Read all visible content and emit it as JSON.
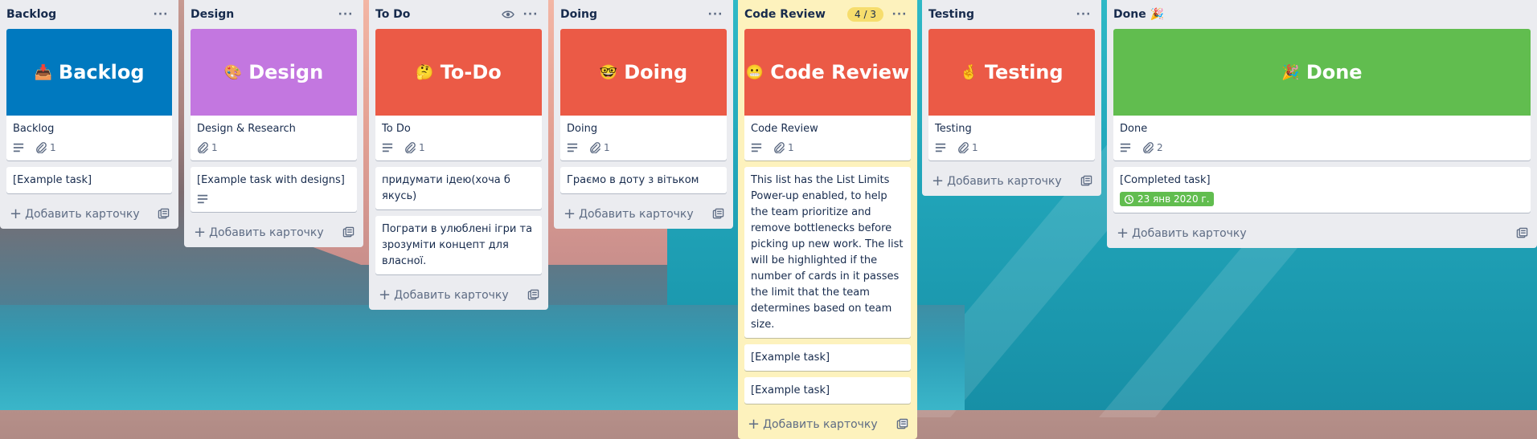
{
  "add_card_label": "Добавить карточку",
  "lists": [
    {
      "key": "backlog",
      "title": "Backlog",
      "cover": {
        "emoji": "📥",
        "text": "Backlog",
        "color": "#0079bf"
      },
      "cover_card": {
        "title": "Backlog",
        "description": true,
        "attachments": "1"
      },
      "cards": [
        {
          "title": "[Example task]"
        }
      ]
    },
    {
      "key": "design",
      "title": "Design",
      "cover": {
        "emoji": "🎨",
        "text": "Design",
        "color": "#c377e0"
      },
      "cover_card": {
        "title": "Design & Research",
        "description": false,
        "attachments": "1"
      },
      "cards": [
        {
          "title": "[Example task with designs]",
          "description": true
        }
      ]
    },
    {
      "key": "todo",
      "title": "To Do",
      "watch_icon": "eye-icon",
      "cover": {
        "emoji": "🤔",
        "text": "To-Do",
        "color": "#eb5a46"
      },
      "cover_card": {
        "title": "To Do",
        "description": true,
        "attachments": "1"
      },
      "cards": [
        {
          "title": "придумати ідею(хоча б якусь)"
        },
        {
          "title": "Пограти в улюблені ігри та зрозуміти концепт для власної."
        }
      ]
    },
    {
      "key": "doing",
      "title": "Doing",
      "cover": {
        "emoji": "🤓",
        "text": "Doing",
        "color": "#eb5a46"
      },
      "cover_card": {
        "title": "Doing",
        "description": true,
        "attachments": "1"
      },
      "cards": [
        {
          "title": "Граємо в доту з вітьком"
        }
      ]
    },
    {
      "key": "code-review",
      "title": "Code Review",
      "limit_badge": "4 / 3",
      "cover": {
        "emoji": "😬",
        "text": "Code Review",
        "color": "#eb5a46"
      },
      "cover_card": {
        "title": "Code Review",
        "description": true,
        "attachments": "1"
      },
      "cards": [
        {
          "title": "This list has the List Limits Power-up enabled, to help the team prioritize and remove bottlenecks before picking up new work. The list will be highlighted if the number of cards in it passes the limit that the team determines based on team size."
        },
        {
          "title": "[Example task]"
        },
        {
          "title": "[Example task]"
        }
      ]
    },
    {
      "key": "testing",
      "title": "Testing",
      "cover": {
        "emoji": "🤞",
        "text": "Testing",
        "color": "#eb5a46"
      },
      "cover_card": {
        "title": "Testing",
        "description": true,
        "attachments": "1"
      },
      "cards": []
    },
    {
      "key": "done",
      "title": "Done 🎉",
      "cover": {
        "emoji": "🎉",
        "text": "Done",
        "color": "#61bd4f"
      },
      "cover_card": {
        "title": "Done",
        "description": true,
        "attachments": "2"
      },
      "cards": [
        {
          "title": "[Completed task]",
          "due": "23 янв 2020 г."
        }
      ]
    }
  ],
  "colors": {
    "list_bg": "#ebecf0",
    "limit_list_bg": "#fdf2bd",
    "limit_badge": "#f6dd6d",
    "due_complete": "#61bd4f"
  }
}
